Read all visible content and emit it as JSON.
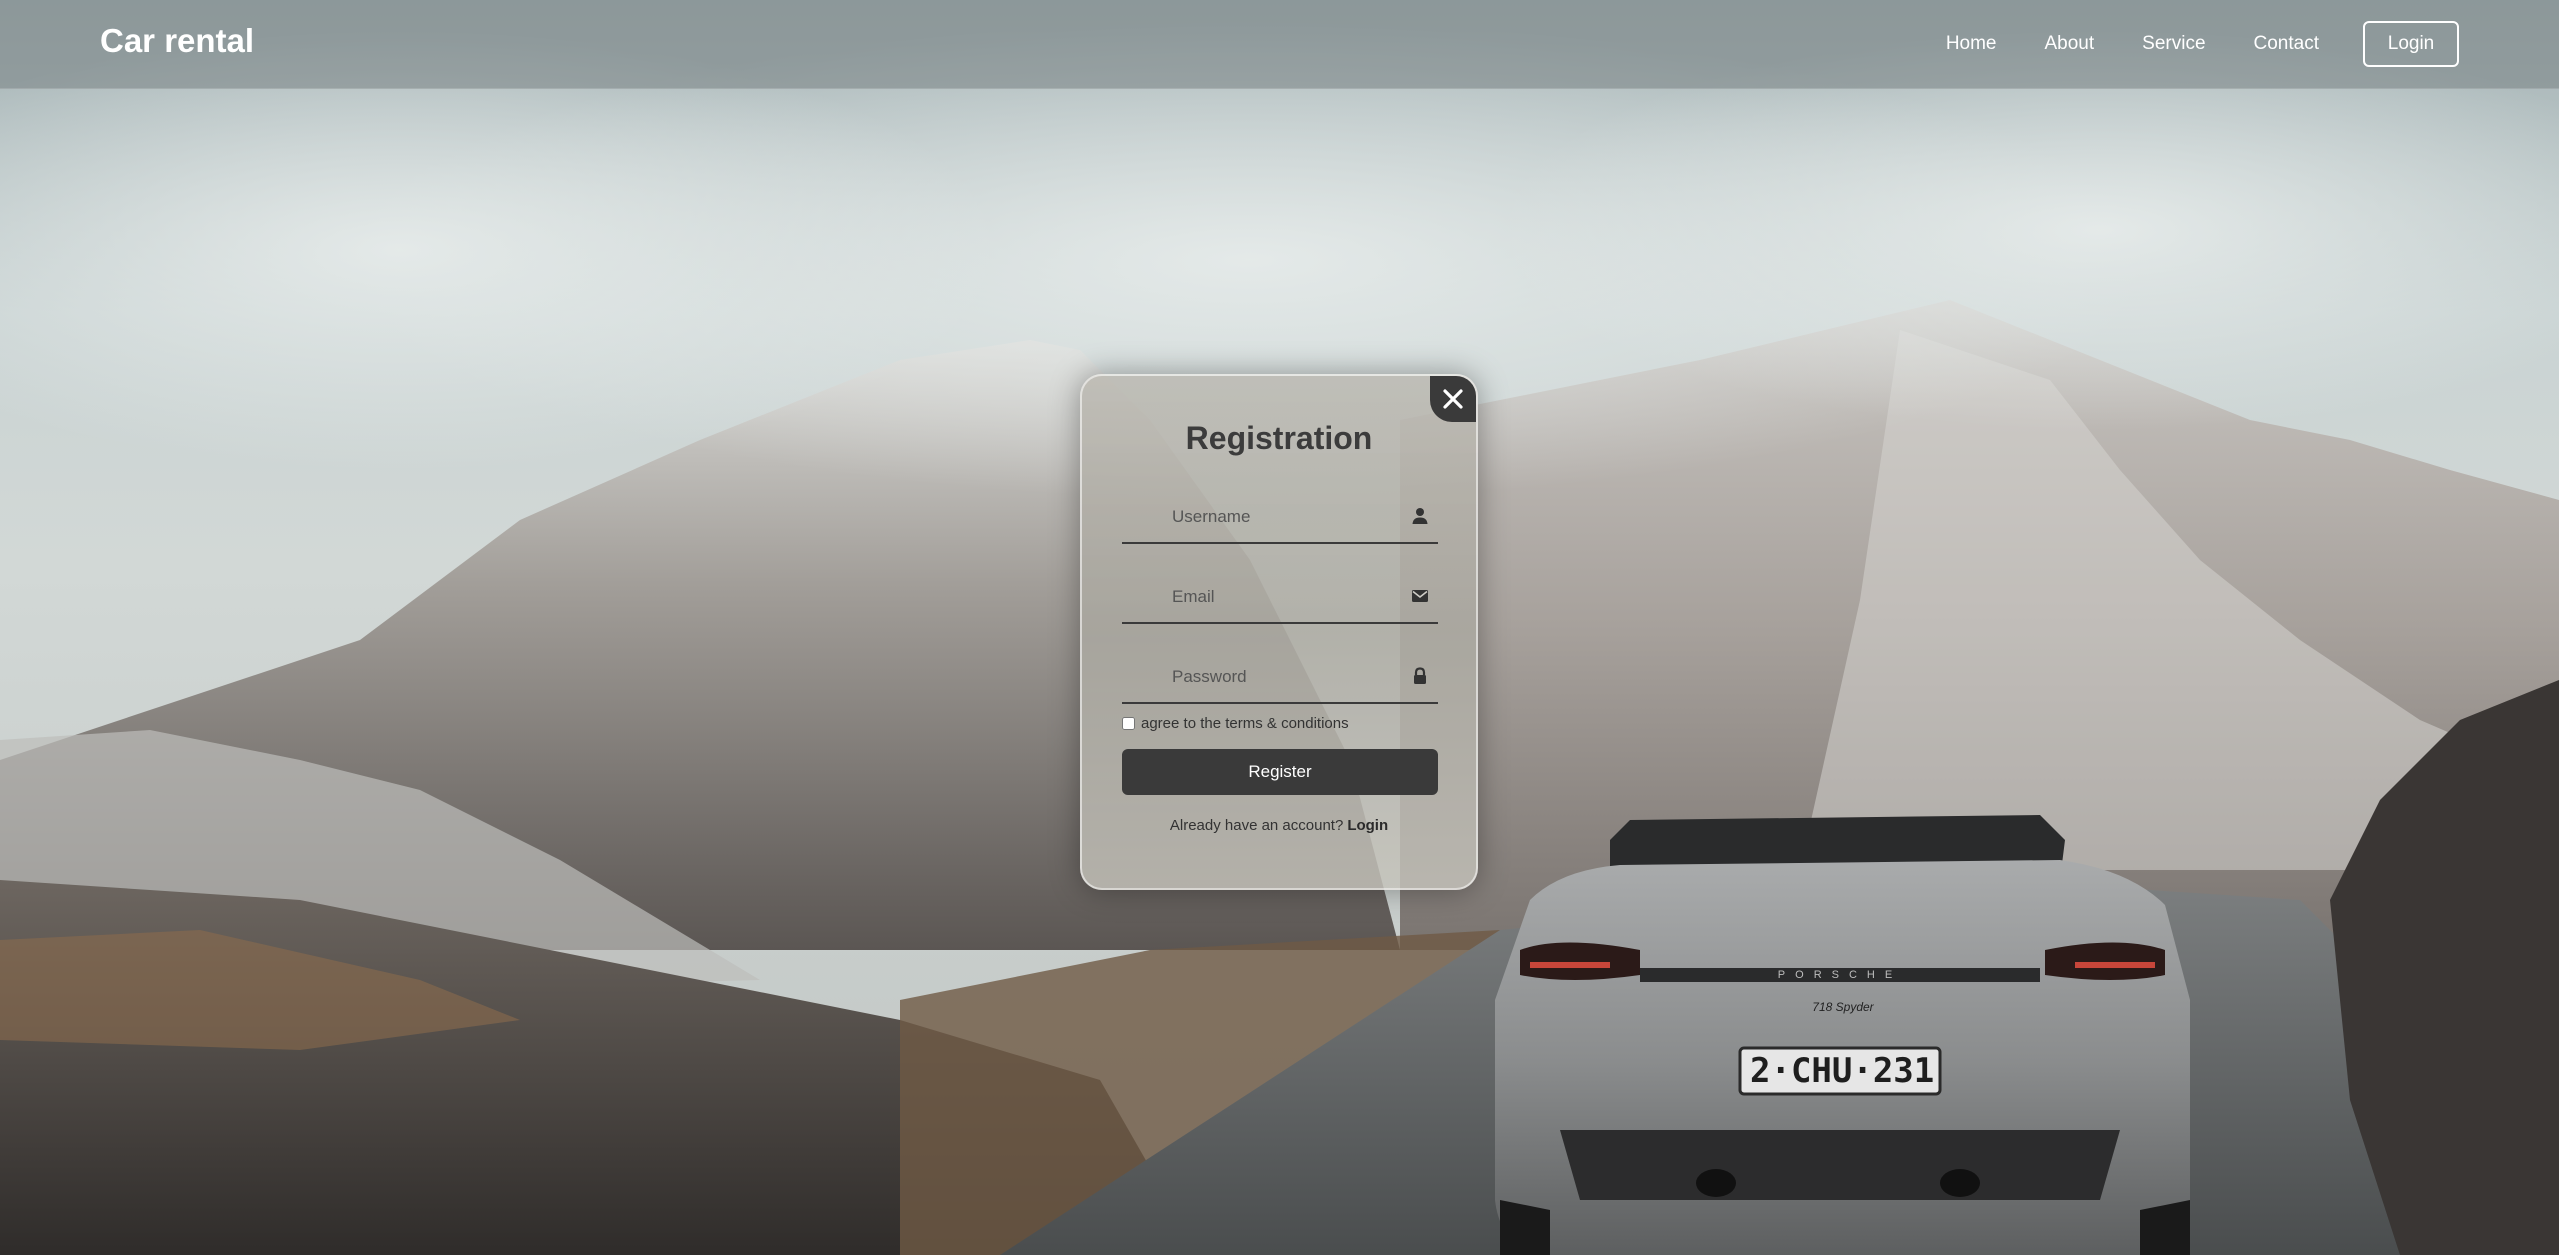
{
  "header": {
    "brand": "Car rental",
    "nav": [
      "Home",
      "About",
      "Service",
      "Contact"
    ],
    "login_label": "Login"
  },
  "modal": {
    "title": "Registration",
    "username_placeholder": "Username",
    "email_placeholder": "Email",
    "password_placeholder": "Password",
    "terms_label": "agree to the terms & conditions",
    "register_label": "Register",
    "account_prompt": "Already have an account?",
    "login_link": "Login"
  },
  "car": {
    "plate": "2·CHU·231",
    "model_badge": "718 Spyder",
    "brand_strip": "PORSCHE"
  },
  "icons": {
    "user": "user-icon",
    "email": "envelope-icon",
    "password": "lock-icon",
    "close": "close-icon"
  },
  "colors": {
    "button_dark": "#3a3a3a",
    "header_text": "#ffffff"
  }
}
